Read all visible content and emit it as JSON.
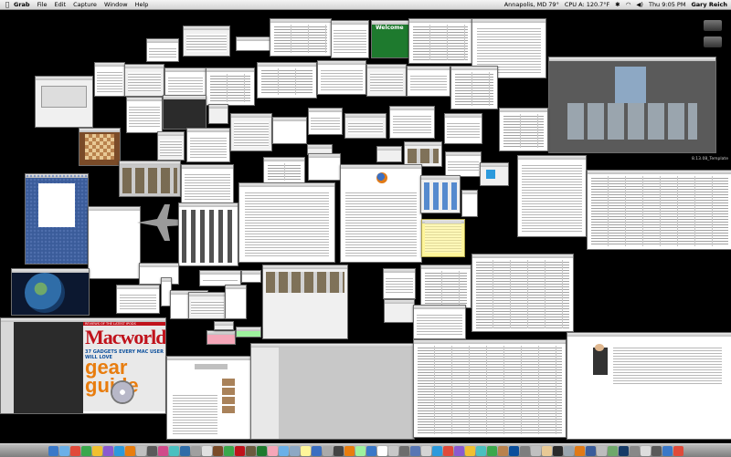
{
  "menubar": {
    "apple": "",
    "app": "Grab",
    "menus": [
      "File",
      "Edit",
      "Capture",
      "Window",
      "Help"
    ],
    "location": "Annapolis, MD 79°",
    "cpu": "CPU A: 120.7°F",
    "clock": "Thu 9:05 PM",
    "user": "Gary Reich"
  },
  "windows": {
    "welcome_title": "Welcome",
    "macworld_title": "Macworld",
    "macworld_subtitle": "REVIEWS OF THE LATEST IPODS",
    "macworld_gadgets": "37 GADGETS EVERY MAC USER WILL LOVE",
    "macworld_gear": "gear guide",
    "desktop_label": "8.13.08_Template"
  },
  "dock": {
    "colors": [
      "#3a78c8",
      "#6bb0e8",
      "#e04a3a",
      "#3aa84c",
      "#f0c030",
      "#8a5ad0",
      "#2c9adc",
      "#e87d0f",
      "#c0c0c0",
      "#5a5a5a",
      "#d04a8a",
      "#4ac0c0",
      "#2f6da8",
      "#a0a0a0",
      "#e0e0e0",
      "#7a4b28",
      "#3aa84c",
      "#c0121b",
      "#6b5b3e",
      "#1e7a2e",
      "#f5a6b8",
      "#6bb0e8",
      "#8da8c4",
      "#fff59a",
      "#3b6fc2",
      "#aaaaaa",
      "#444444",
      "#e87d0f",
      "#9ef29e",
      "#3a78c8",
      "#ffffff",
      "#c8c8c8",
      "#6d6d6d",
      "#5877b4",
      "#d4d4d4",
      "#2c9adc",
      "#e04a3a",
      "#8a5ad0",
      "#f0c030",
      "#4ac0c0",
      "#3aa84c",
      "#b9824d",
      "#0b4f9c",
      "#7e7e7e",
      "#c0c0c0",
      "#e8c995",
      "#2b2b2b",
      "#9aa5ae",
      "#e07a17",
      "#3a5c9a",
      "#bdbdbd",
      "#6fa86a",
      "#163a66",
      "#888888",
      "#dddddd",
      "#5a5a5a",
      "#3a78c8",
      "#e04a3a"
    ]
  }
}
